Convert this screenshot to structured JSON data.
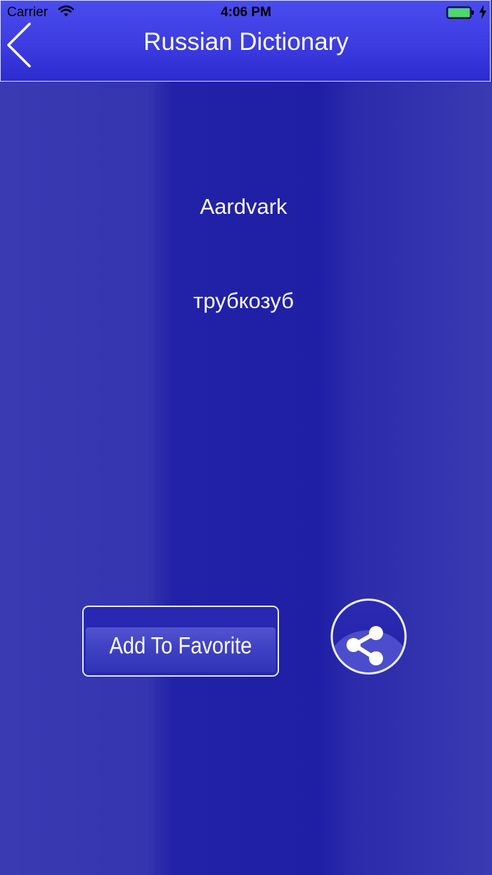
{
  "status_bar": {
    "carrier": "Carrier",
    "time": "4:06 PM",
    "wifi_icon": "wifi-icon",
    "battery_icon": "battery-icon",
    "charging_icon": "charging-bolt-icon"
  },
  "nav": {
    "title": "Russian Dictionary",
    "back_icon": "chevron-left-icon"
  },
  "entry": {
    "word": "Aardvark",
    "translation": "трубкозуб"
  },
  "actions": {
    "favorite_label": "Add To Favorite",
    "share_icon": "share-icon"
  },
  "colors": {
    "background": "#2222a8",
    "nav_bar": "#3c3ce0",
    "text": "#ffffff",
    "battery": "#4cd964"
  }
}
